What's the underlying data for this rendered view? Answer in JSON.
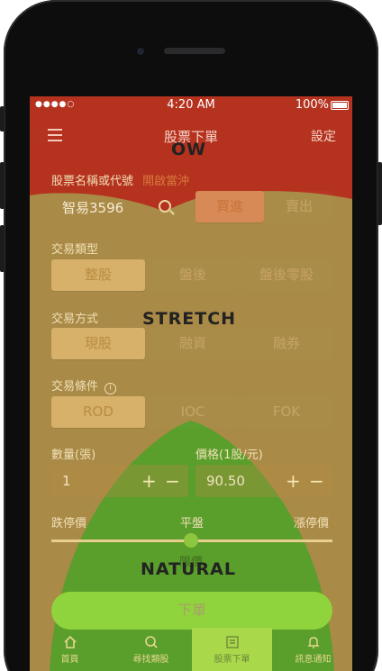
{
  "status": {
    "time": "4:20 AM",
    "battery": "100%",
    "signal": "●●●●○"
  },
  "nav": {
    "title": "股票下單",
    "settings": "設定"
  },
  "stock": {
    "label": "股票名稱或代號",
    "link": "開啟當沖",
    "value": "智易3596"
  },
  "side": {
    "buy": "買進",
    "sell": "賣出"
  },
  "trade_type": {
    "label": "交易類型",
    "options": [
      "整股",
      "盤後",
      "盤後零股"
    ]
  },
  "trade_method": {
    "label": "交易方式",
    "options": [
      "現股",
      "融資",
      "融券"
    ]
  },
  "condition": {
    "label": "交易條件",
    "options": [
      "ROD",
      "IOC",
      "FOK"
    ]
  },
  "quantity": {
    "label": "數量(張)",
    "value": "1"
  },
  "price": {
    "label": "價格(1股/元)",
    "value": "90.50"
  },
  "range": {
    "low": "跌停價",
    "mid": "平盤",
    "high": "漲停價",
    "ref": "限價"
  },
  "submit_label": "下單",
  "tabs": [
    "首頁",
    "尋找類股",
    "股票下單",
    "訊息通知"
  ],
  "overlay": {
    "ow": "OW",
    "stretch": "STRETCH",
    "natural": "NATURAL"
  },
  "colors": {
    "red_zone": "#b5321f",
    "yellow_zone": "#a98a46",
    "green_zone": "#5a9e2c",
    "accent": "#8fd33d"
  }
}
